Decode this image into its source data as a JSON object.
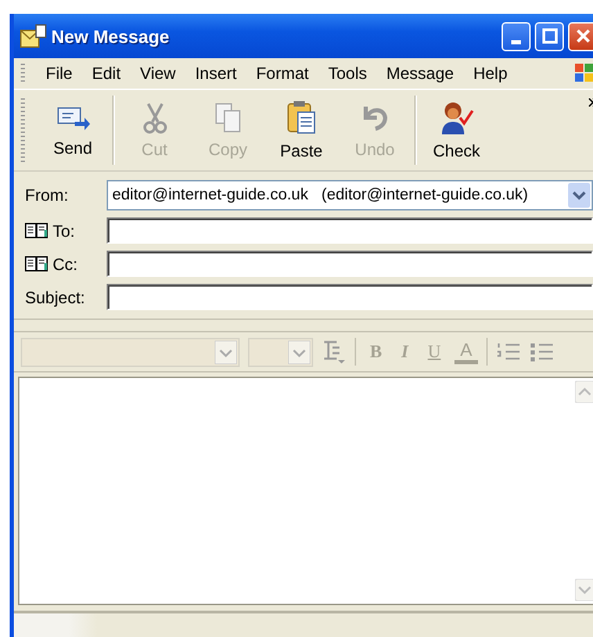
{
  "window": {
    "title": "New Message"
  },
  "menu": [
    "File",
    "Edit",
    "View",
    "Insert",
    "Format",
    "Tools",
    "Message",
    "Help"
  ],
  "toolbar": [
    {
      "label": "Send",
      "kind": "send",
      "disabled": false
    },
    {
      "label": "Cut",
      "kind": "cut",
      "disabled": true
    },
    {
      "label": "Copy",
      "kind": "copy",
      "disabled": true
    },
    {
      "label": "Paste",
      "kind": "paste",
      "disabled": false
    },
    {
      "label": "Undo",
      "kind": "undo",
      "disabled": true
    },
    {
      "label": "Check",
      "kind": "check",
      "disabled": false
    }
  ],
  "fields": [
    {
      "label": "From:",
      "kind": "select",
      "value": "editor@internet-guide.co.uk   (editor@internet-guide.co.uk)"
    },
    {
      "label": "To:",
      "kind": "address"
    },
    {
      "label": "Cc:",
      "kind": "address"
    },
    {
      "label": "Subject:",
      "kind": "text"
    }
  ],
  "format_toolbar": {
    "disabled": true,
    "buttons": [
      {
        "label": "B",
        "kind": "bold"
      },
      {
        "label": "I",
        "kind": "italic"
      },
      {
        "label": "U",
        "kind": "underline"
      },
      {
        "label": "A",
        "kind": "color"
      }
    ]
  }
}
